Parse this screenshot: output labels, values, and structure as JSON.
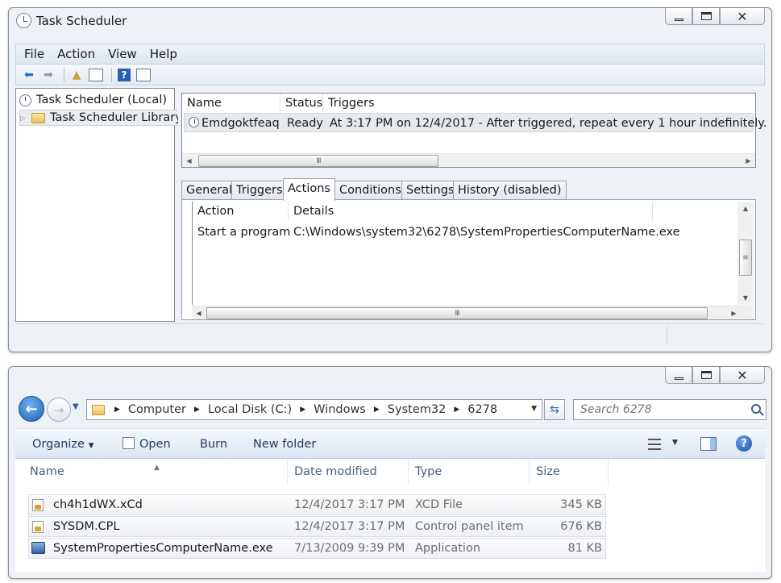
{
  "scheduler": {
    "title": "Task Scheduler",
    "menu": [
      "File",
      "Action",
      "View",
      "Help"
    ],
    "tree": {
      "root": "Task Scheduler (Local)",
      "library": "Task Scheduler Library"
    },
    "tasks": {
      "columns": [
        "Name",
        "Status",
        "Triggers"
      ],
      "rows": [
        {
          "name": "Emdgoktfeaq",
          "status": "Ready",
          "triggers": "At 3:17 PM on 12/4/2017 - After triggered, repeat every 1 hour indefinitely."
        }
      ]
    },
    "tabs": [
      "General",
      "Triggers",
      "Actions",
      "Conditions",
      "Settings",
      "History (disabled)"
    ],
    "active_tab": "Actions",
    "actions": {
      "columns": [
        "Action",
        "Details"
      ],
      "rows": [
        {
          "action": "Start a program",
          "details": "C:\\Windows\\system32\\6278\\SystemPropertiesComputerName.exe"
        }
      ]
    }
  },
  "explorer": {
    "breadcrumb": [
      "Computer",
      "Local Disk (C:)",
      "Windows",
      "System32",
      "6278"
    ],
    "search_placeholder": "Search 6278",
    "commands": {
      "organize": "Organize",
      "open": "Open",
      "burn": "Burn",
      "new_folder": "New folder"
    },
    "columns": [
      "Name",
      "Date modified",
      "Type",
      "Size"
    ],
    "files": [
      {
        "name": "ch4h1dWX.xCd",
        "date": "12/4/2017 3:17 PM",
        "type": "XCD File",
        "size": "345 KB",
        "icon": "locked-file-icon"
      },
      {
        "name": "SYSDM.CPL",
        "date": "12/4/2017 3:17 PM",
        "type": "Control panel item",
        "size": "676 KB",
        "icon": "locked-file-icon"
      },
      {
        "name": "SystemPropertiesComputerName.exe",
        "date": "7/13/2009 9:39 PM",
        "type": "Application",
        "size": "81 KB",
        "icon": "application-icon"
      }
    ]
  }
}
